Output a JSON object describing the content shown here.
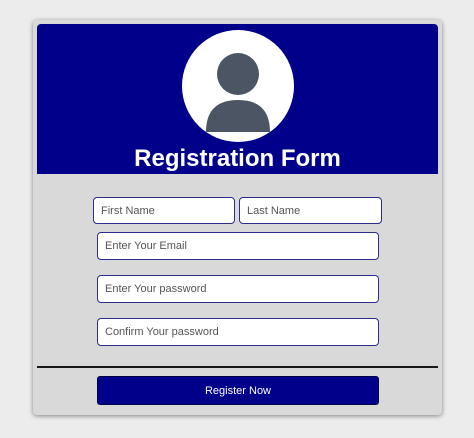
{
  "form": {
    "title": "Registration Form",
    "avatar_icon": "user-avatar-icon",
    "fields": {
      "first_name_placeholder": "First Name",
      "last_name_placeholder": "Last Name",
      "email_placeholder": "Enter Your Email",
      "password_placeholder": "Enter Your password",
      "confirm_password_placeholder": "Confirm Your password"
    },
    "submit_label": "Register Now"
  },
  "colors": {
    "header_bg": "#00008b",
    "card_bg": "#d9d9d9",
    "page_bg": "#ececec",
    "field_border": "#2c2c8e",
    "avatar_fill": "#4b5563"
  }
}
